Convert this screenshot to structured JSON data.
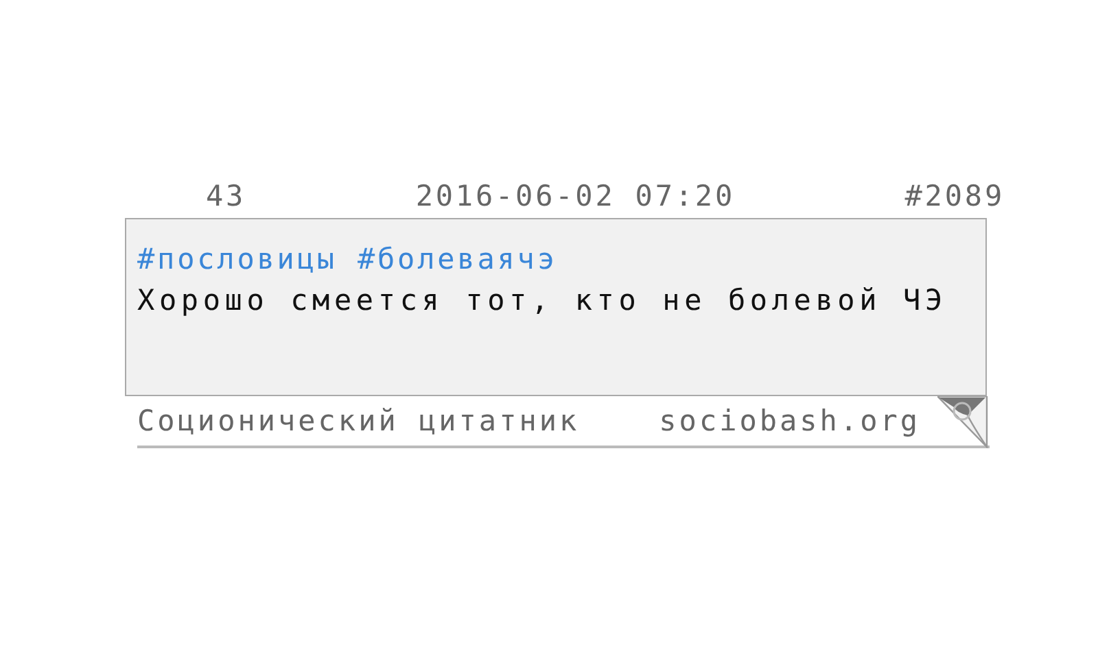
{
  "header": {
    "rating": "43",
    "date": "2016-06-02 07:20",
    "number": "#2089"
  },
  "quote": {
    "tags": [
      "#пословицы",
      "#болеваячэ"
    ],
    "text": "Хорошо смеется тот, кто не болевой ЧЭ"
  },
  "footer": {
    "site_title": "Соционический цитатник",
    "site_url": "sociobash.org"
  }
}
